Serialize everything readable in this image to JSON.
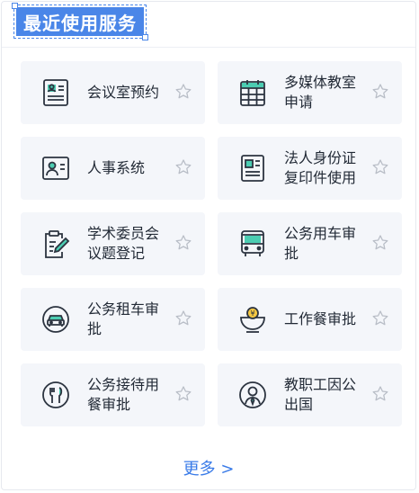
{
  "header": {
    "title": "最近使用服务"
  },
  "services": [
    {
      "label": "会议室预约",
      "icon": "id-card-icon"
    },
    {
      "label": "多媒体教室申请",
      "icon": "calendar-icon"
    },
    {
      "label": "人事系统",
      "icon": "person-card-icon"
    },
    {
      "label": "法人身份证复印件使用",
      "icon": "document-icon"
    },
    {
      "label": "学术委员会议题登记",
      "icon": "clipboard-pen-icon"
    },
    {
      "label": "公务用车审批",
      "icon": "bus-icon"
    },
    {
      "label": "公务租车审批",
      "icon": "car-icon"
    },
    {
      "label": "工作餐审批",
      "icon": "meal-bowl-icon"
    },
    {
      "label": "公务接待用餐审批",
      "icon": "fork-knife-icon"
    },
    {
      "label": "教职工因公出国",
      "icon": "person-tie-icon"
    }
  ],
  "footer": {
    "more_label": "更多 >"
  },
  "colors": {
    "accent": "#3a7be8",
    "icon_stroke": "#2c3440",
    "icon_fill": "#4ccdb2",
    "card_bg": "#f4f6fa"
  }
}
